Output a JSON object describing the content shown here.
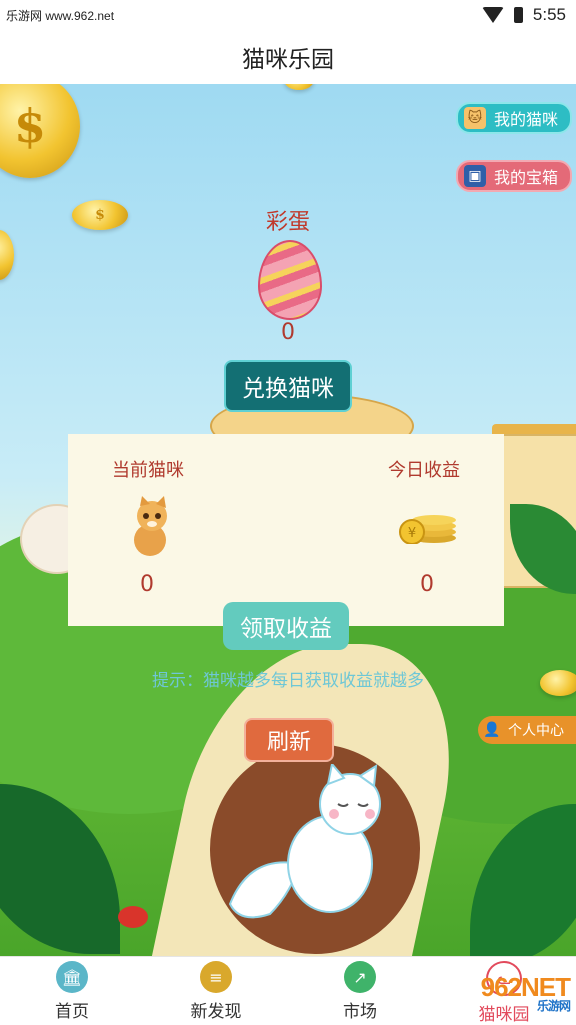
{
  "status_bar": {
    "site": "乐游网 www.962.net",
    "time": "5:55"
  },
  "header": {
    "title": "猫咪乐园"
  },
  "side_buttons": {
    "my_cats": "我的猫咪",
    "my_chest": "我的宝箱",
    "personal_center": "个人中心"
  },
  "egg": {
    "title": "彩蛋",
    "count": "0"
  },
  "exchange_button": "兑换猫咪",
  "panel": {
    "current_cats_label": "当前猫咪",
    "current_cats_value": "0",
    "today_income_label": "今日收益",
    "today_income_value": "0"
  },
  "claim_button": "领取收益",
  "tip": "提示：猫咪越多每日获取收益就越多",
  "refresh_button": "刷新",
  "tabs": [
    {
      "label": "首页",
      "icon": "bank-icon",
      "color": "#5bb6c8"
    },
    {
      "label": "新发现",
      "icon": "coins-icon",
      "color": "#d9a82c"
    },
    {
      "label": "市场",
      "icon": "chart-icon",
      "color": "#3fb36a"
    },
    {
      "label": "猫咪园",
      "icon": "cat-face-icon",
      "color": "#e24a5c",
      "active": true
    }
  ],
  "watermark": {
    "brand": "962NET",
    "sub": "乐游网"
  },
  "colors": {
    "exchange": "#136f73",
    "claim": "#63cbbe",
    "refresh": "#e06a3e",
    "active_tab": "#e24a5c"
  }
}
